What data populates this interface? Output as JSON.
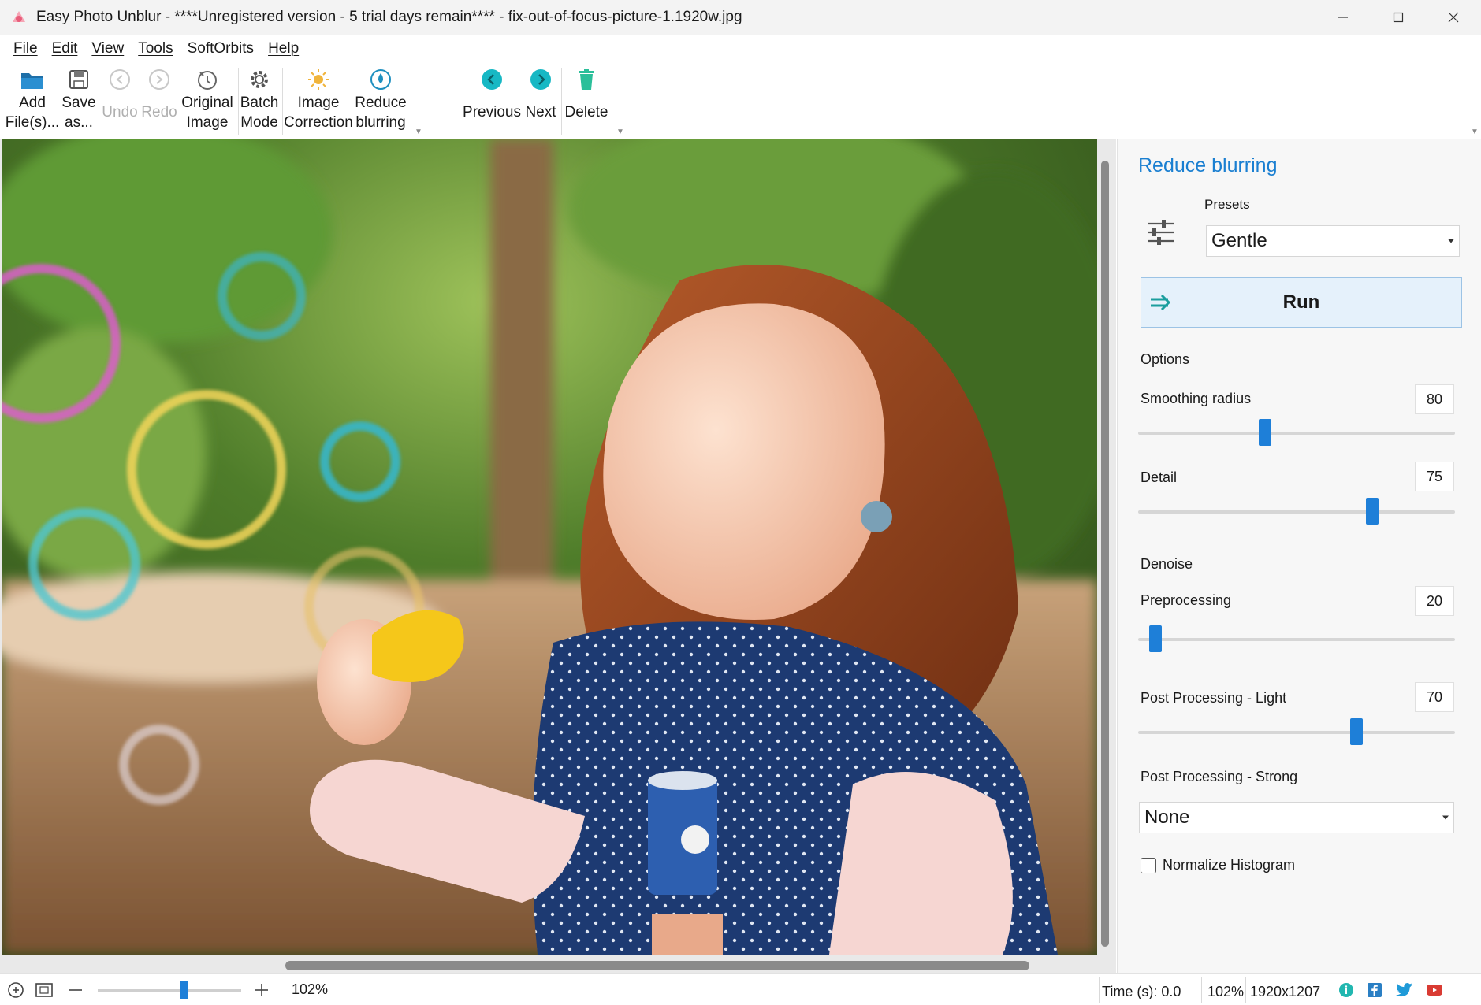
{
  "window": {
    "title": "Easy Photo Unblur - ****Unregistered version - 5 trial days remain**** - fix-out-of-focus-picture-1.1920w.jpg",
    "controls": [
      "minimize-icon",
      "maximize-icon",
      "close-icon"
    ]
  },
  "menu": {
    "items": [
      "File",
      "Edit",
      "View",
      "Tools",
      "SoftOrbits",
      "Help"
    ]
  },
  "toolbar": {
    "add_files": "Add\nFile(s)...",
    "save_as": "Save\nas...",
    "undo": "Undo",
    "redo": "Redo",
    "original_image": "Original\nImage",
    "batch_mode": "Batch\nMode",
    "image_correction": "Image\nCorrection",
    "reduce_blurring": "Reduce\nblurring",
    "previous": "Previous",
    "next": "Next",
    "delete": "Delete",
    "colors": {
      "accent": "#1e8fbf",
      "nav_teal": "#17b8c4",
      "delete_green": "#2bbf9a"
    }
  },
  "panel": {
    "title": "Reduce blurring",
    "presets_label": "Presets",
    "preset_value": "Gentle",
    "run_label": "Run",
    "options_label": "Options",
    "smoothing_radius": {
      "label": "Smoothing radius",
      "value": "80",
      "fraction": 0.4
    },
    "detail": {
      "label": "Detail",
      "value": "75",
      "fraction": 0.74
    },
    "denoise_label": "Denoise",
    "preprocessing": {
      "label": "Preprocessing",
      "value": "20",
      "fraction": 0.055
    },
    "post_light": {
      "label": "Post Processing - Light",
      "value": "70",
      "fraction": 0.69
    },
    "post_strong": {
      "label": "Post Processing - Strong",
      "value": "None"
    },
    "normalize_histogram": {
      "label": "Normalize Histogram",
      "checked": false
    },
    "colors": {
      "title": "#1a7fd1",
      "slider": "#1e7fd8",
      "run_bg": "#e5f1fb"
    }
  },
  "statusbar": {
    "zoom_value": "102%",
    "zoom_fraction": 0.6,
    "time": "Time (s): 0.0",
    "zoom_short": "102%",
    "dimensions": "1920x1207",
    "social_icons": [
      "info-icon",
      "facebook-icon",
      "twitter-icon",
      "youtube-icon"
    ]
  }
}
